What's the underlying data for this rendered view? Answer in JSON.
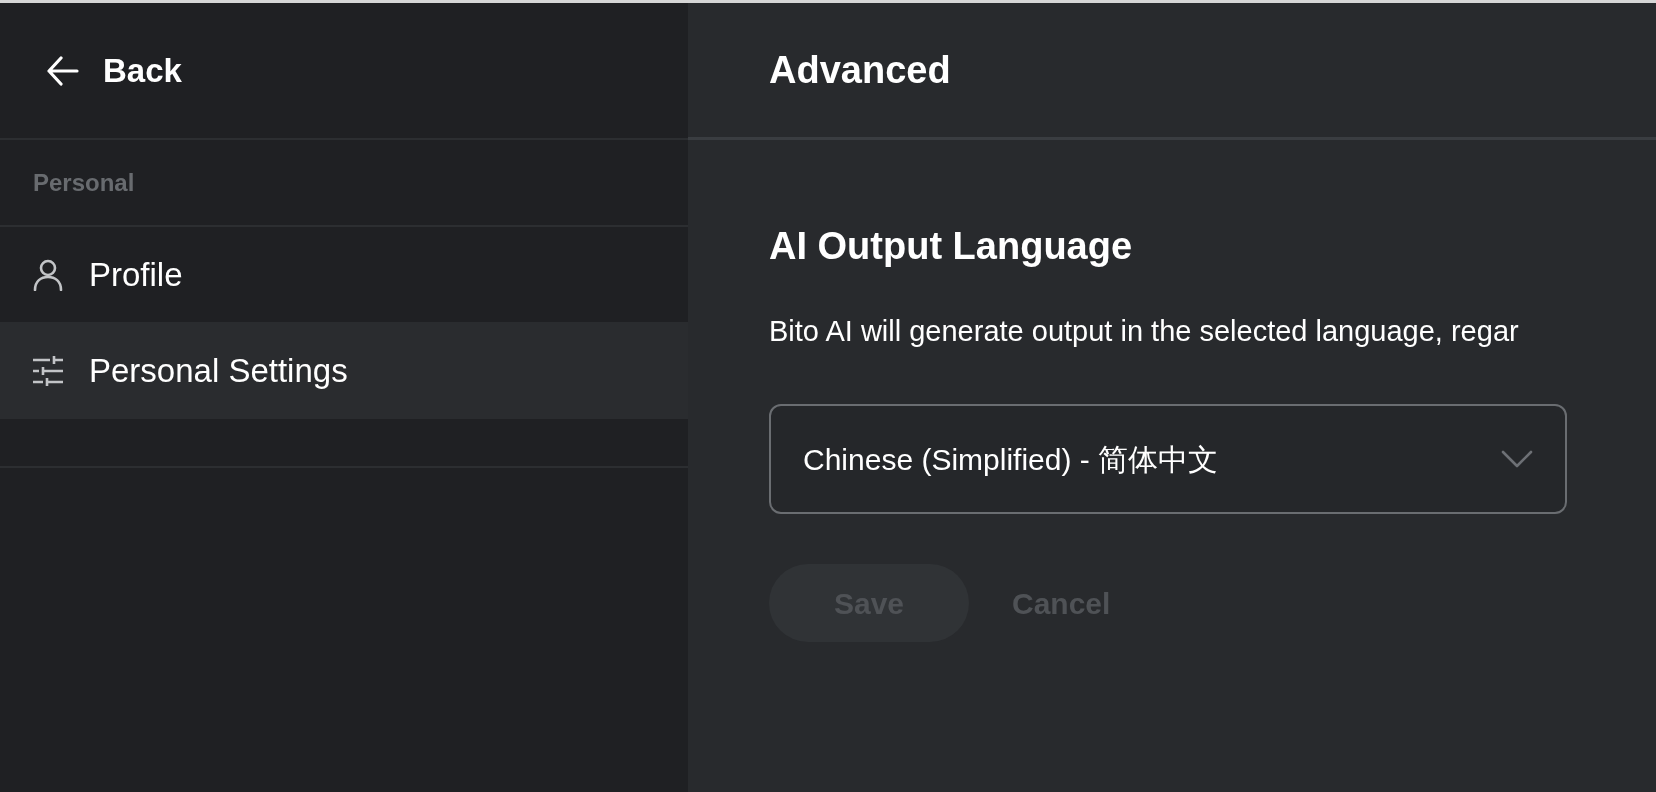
{
  "sidebar": {
    "back": {
      "label": "Back"
    },
    "section_label": "Personal",
    "items": [
      {
        "label": "Profile",
        "selected": false
      },
      {
        "label": "Personal Settings",
        "selected": true
      }
    ]
  },
  "main": {
    "title": "Advanced",
    "section": {
      "heading": "AI Output Language",
      "description": "Bito AI will generate output in the selected language, regar",
      "select": {
        "value": "Chinese (Simplified) - 简体中文"
      },
      "buttons": [
        {
          "label": "Save",
          "kind": "filled",
          "disabled": true
        },
        {
          "label": "Cancel",
          "kind": "text",
          "disabled": true
        }
      ]
    }
  }
}
